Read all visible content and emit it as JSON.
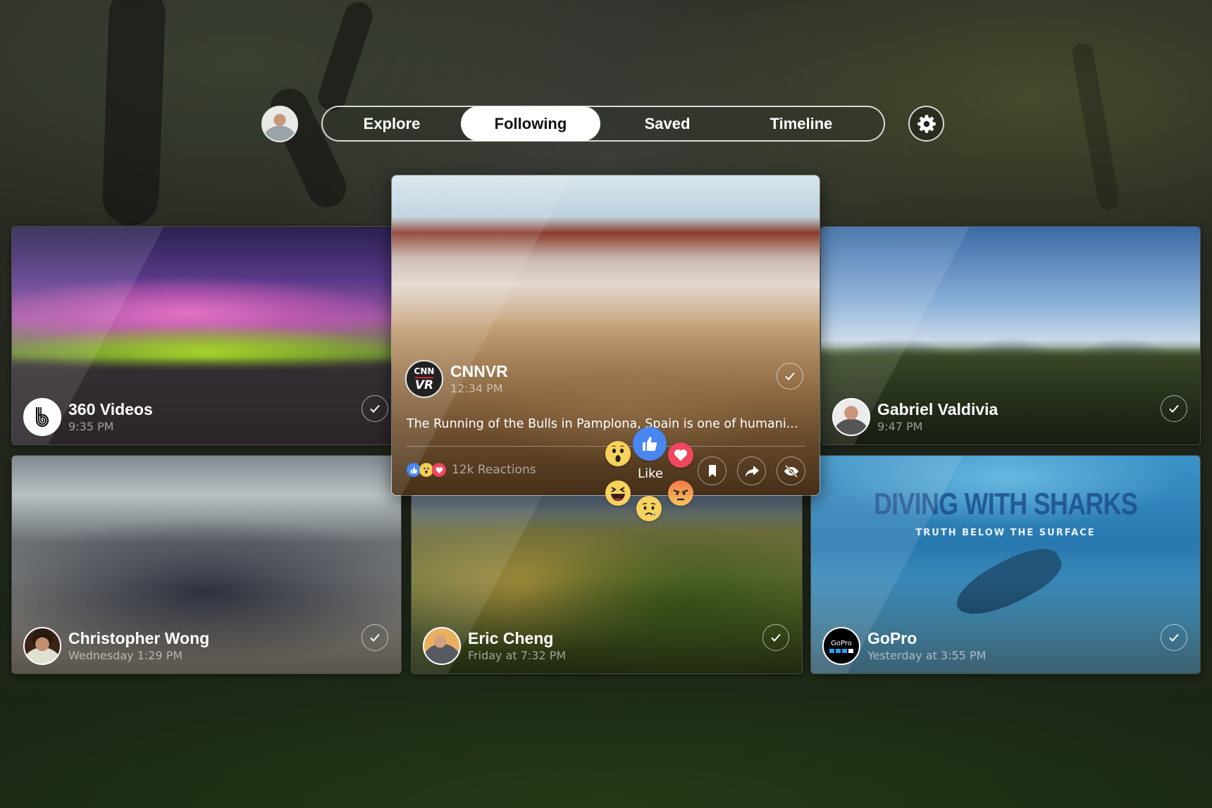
{
  "nav": {
    "profile_avatar": "user-avatar",
    "tabs": [
      {
        "label": "Explore",
        "active": false
      },
      {
        "label": "Following",
        "active": true
      },
      {
        "label": "Saved",
        "active": false
      },
      {
        "label": "Timeline",
        "active": false
      }
    ],
    "settings_icon": "gear-icon"
  },
  "feed": {
    "cards": [
      {
        "id": "360videos",
        "name": "360 Videos",
        "time": "9:35 PM",
        "avatar": "360-videos-logo",
        "checked": true
      },
      {
        "id": "cnnvr",
        "name": "CNNVR",
        "time": "12:34 PM",
        "avatar_line1": "CNN",
        "avatar_line2": "VR",
        "description": "The Running of the Bulls in Pamplona, Spain is one of humani...",
        "reactions_count": "12k Reactions",
        "focused": true
      },
      {
        "id": "gabriel",
        "name": "Gabriel Valdivia",
        "time": "9:47 PM",
        "checked": true
      },
      {
        "id": "christopher",
        "name": "Christopher Wong",
        "time": "Wednesday 1:29 PM",
        "checked": true
      },
      {
        "id": "eric",
        "name": "Eric Cheng",
        "time": "Friday at 7:32 PM",
        "checked": true
      },
      {
        "id": "gopro",
        "name": "GoPro",
        "time": "Yesterday at 3:55 PM",
        "avatar_text": "GoPro",
        "thumbnail_title": "DIVING WITH SHARKS",
        "thumbnail_subtitle": "TRUTH BELOW THE SURFACE",
        "checked": true
      }
    ]
  },
  "reaction_picker": {
    "hover_label": "Like",
    "options": [
      "like",
      "love",
      "haha",
      "wow",
      "sad",
      "angry"
    ]
  },
  "actions": [
    "save",
    "share",
    "hide"
  ],
  "colors": {
    "like_blue": "#4a86f2",
    "love_red": "#f0465e",
    "emoji_yellow": "#f8d25c",
    "active_tab_bg": "#ffffff"
  }
}
